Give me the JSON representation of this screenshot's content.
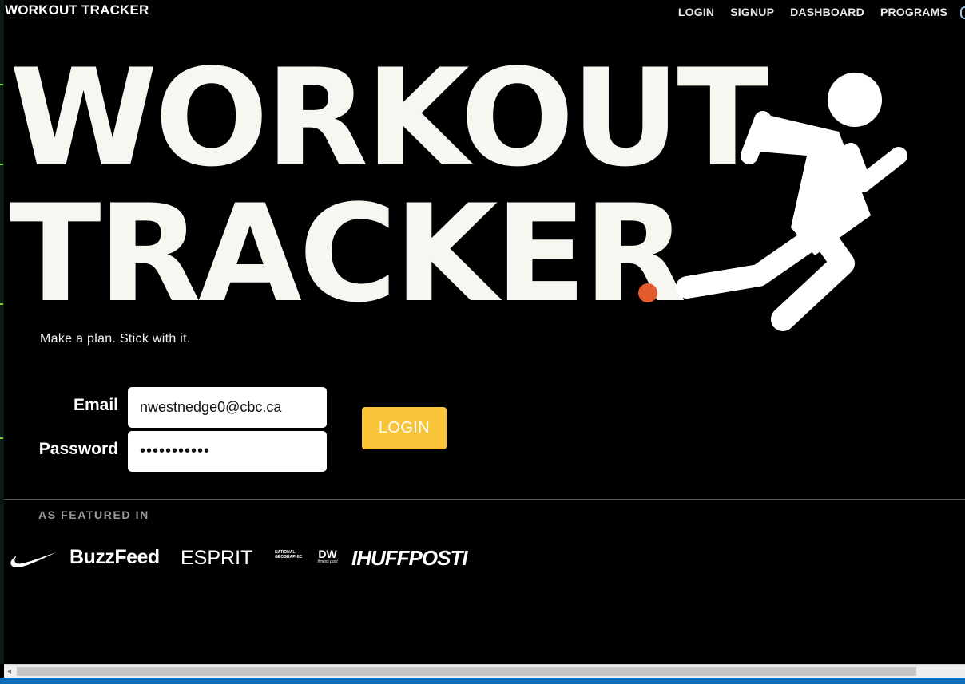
{
  "brand": {
    "title": "WORKOUT TRACKER"
  },
  "nav": {
    "items": [
      "LOGIN",
      "SIGNUP",
      "DASHBOARD",
      "PROGRAMS"
    ]
  },
  "hero": {
    "line1": "WORKOUT",
    "line2": "TRACKER",
    "tagline": "Make a plan. Stick with it.",
    "accent_color": "#e05a2b"
  },
  "form": {
    "email_label": "Email",
    "email_value": "nwestnedge0@cbc.ca",
    "password_label": "Password",
    "password_value": "•••••••••••",
    "login_label": "LOGIN",
    "button_color": "#f9c33a"
  },
  "featured": {
    "heading": "AS FEATURED IN",
    "logos": {
      "nike": "nike-swoosh-icon",
      "buzzfeed": "BuzzFeed",
      "esprit": "ESPRIT",
      "natgeo": "NATIONAL GEOGRAPHIC",
      "dw": "DW",
      "dw_sub": "fitness post",
      "huffpost": "IHUFFPOSTI"
    }
  },
  "colors": {
    "background": "#000000",
    "text": "#f7f6f1"
  }
}
